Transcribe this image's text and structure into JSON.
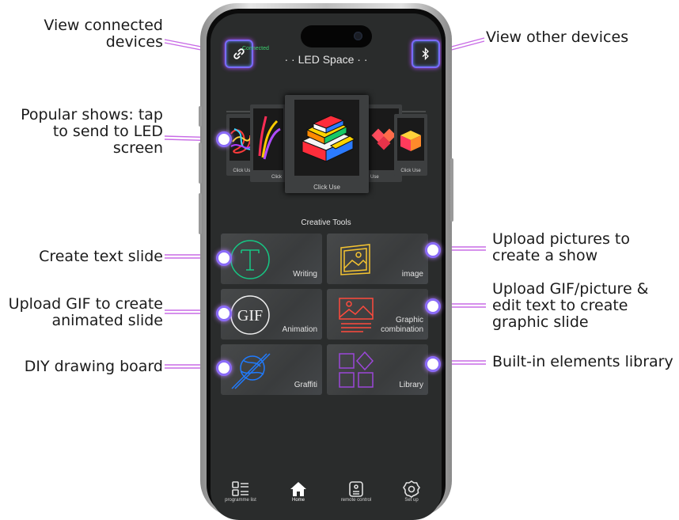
{
  "callouts": {
    "connected_devices": "View connected devices",
    "other_devices": "View other devices",
    "popular_shows": "Popular shows: tap to send to LED screen",
    "text_slide": "Create text slide",
    "gif_slide": "Upload GIF to create animated slide",
    "drawing": "DIY drawing board",
    "pictures": "Upload pictures to create a show",
    "gif_picture_text": "Upload GIF/picture & edit text to create graphic slide",
    "elements_library": "Built-in elements library"
  },
  "app": {
    "title": "· · LED Space · ·",
    "connection_status": "Connected",
    "link_icon": "link-icon",
    "bluetooth_icon": "bluetooth-icon"
  },
  "carousel": {
    "cards": [
      {
        "caption": "Click Use"
      },
      {
        "caption": "Click"
      },
      {
        "caption": "Click Use"
      },
      {
        "caption": "Use"
      },
      {
        "caption": "Click Use"
      }
    ]
  },
  "tools": {
    "section_title": "Creative Tools",
    "items": [
      {
        "label": "Writing",
        "icon": "text-t-icon"
      },
      {
        "label": "image",
        "icon": "picture-icon"
      },
      {
        "label": "Animation",
        "icon": "gif-icon"
      },
      {
        "label": "Graphic combination",
        "icon": "graphic-combination-icon"
      },
      {
        "label": "Graffiti",
        "icon": "graffiti-icon"
      },
      {
        "label": "Library",
        "icon": "library-shapes-icon"
      }
    ]
  },
  "tabbar": {
    "items": [
      {
        "label": "programme list",
        "icon": "list-icon"
      },
      {
        "label": "Home",
        "icon": "home-icon",
        "active": true
      },
      {
        "label": "remote control",
        "icon": "remote-icon"
      },
      {
        "label": "Set up",
        "icon": "settings-icon"
      }
    ]
  },
  "colors": {
    "accent_purple": "#8a6bf7",
    "connected_green": "#3cd070",
    "screen_bg": "#2a2c2c"
  }
}
